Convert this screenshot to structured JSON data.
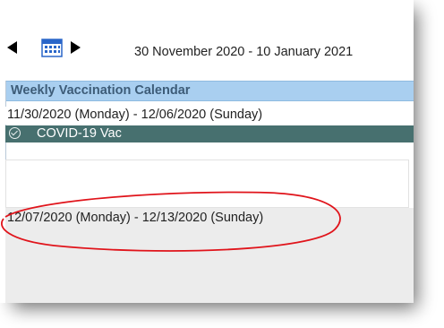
{
  "nav": {
    "prev_icon": "triangle-left-icon",
    "calendar_icon": "calendar-icon",
    "next_icon": "triangle-right-icon",
    "date_range": "30 November 2020  -  10 January 2021"
  },
  "calendar": {
    "header": "Weekly Vaccination Calendar",
    "weeks": [
      {
        "label": "11/30/2020 (Monday) - 12/06/2020 (Sunday)",
        "events": [
          {
            "label": "COVID-19 Vac",
            "icon": "check-circle-icon"
          }
        ]
      },
      {
        "label": "12/07/2020 (Monday) - 12/13/2020 (Sunday)",
        "events": []
      }
    ]
  },
  "colors": {
    "header_bg": "#a9cff0",
    "header_text": "#3d5c78",
    "event_bg": "#47706f",
    "annotation": "#e0141b",
    "calendar_icon": "#2a66c9"
  }
}
